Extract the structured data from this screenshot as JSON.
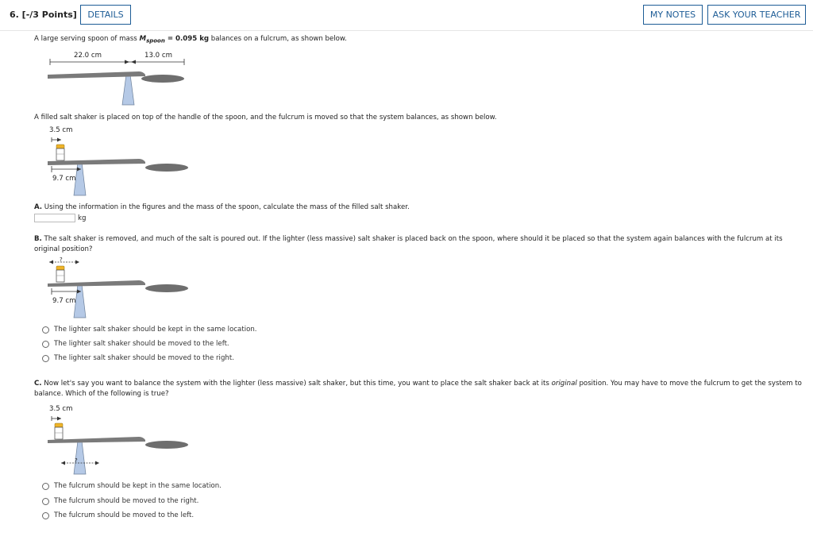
{
  "header": {
    "points": "6.  [-/3 Points]",
    "details": "DETAILS",
    "my_notes": "MY NOTES",
    "ask_teacher": "ASK YOUR TEACHER"
  },
  "intro": {
    "prefix": "A large serving spoon of mass ",
    "mass_symbol": "M",
    "mass_sub": "spoon",
    "mass_value": " = 0.095 kg",
    "suffix": " balances on a fulcrum, as shown below."
  },
  "fig1": {
    "left_len": "22.0 cm",
    "right_len": "13.0 cm"
  },
  "para2": "A filled salt shaker is placed on top of the handle of the spoon, and the fulcrum is moved so that the system balances, as shown below.",
  "fig2": {
    "top_dim": "3.5 cm",
    "bottom_dim": "9.7 cm"
  },
  "partA": {
    "letter": "A.",
    "text": " Using the information in the figures and the mass of the spoon, calculate the mass of the filled salt shaker.",
    "unit": "kg",
    "answer_value": ""
  },
  "partB": {
    "letter": "B.",
    "text": " The salt shaker is removed, and much of the salt is poured out. If the lighter (less massive) salt shaker is placed back on the spoon, where should it be placed so that the system again balances with the fulcrum at its original position?",
    "fig_question": "?",
    "fig_dim": "9.7 cm",
    "options": [
      "The lighter salt shaker should be kept in the same location.",
      "The lighter salt shaker should be moved to the left.",
      "The lighter salt shaker should be moved to the right."
    ]
  },
  "partC": {
    "letter": "C.",
    "text_before": " Now let's say you want to balance the system with the lighter (less massive) salt shaker, but this time, you want to place the salt shaker back at its ",
    "text_italic": "original",
    "text_after": " position. You may have to move the fulcrum to get the system to balance. Which of the following is true?",
    "fig_dim": "3.5 cm",
    "fig_question": "?",
    "options": [
      "The fulcrum should be kept in the same location.",
      "The fulcrum should be moved to the right.",
      "The fulcrum should be moved to the left."
    ]
  },
  "colors": {
    "accent": "#1d5c96",
    "spoon": "#808080",
    "fulcrum": "#b5c9e6",
    "shaker_cap": "#f0b429"
  }
}
